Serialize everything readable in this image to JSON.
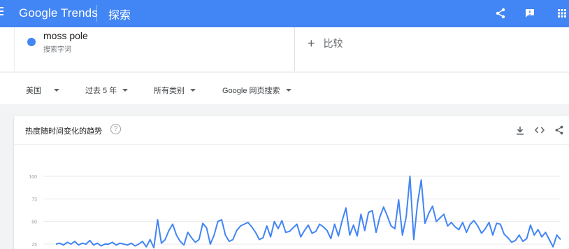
{
  "header": {
    "logo": "Google Trends",
    "page_title": "探索",
    "bg_color": "#4285f4",
    "icons": [
      "menu-icon",
      "share-icon",
      "feedback-icon",
      "apps-icon"
    ]
  },
  "search": {
    "term": "moss pole",
    "term_type": "搜索字词",
    "term_color": "#4285f4",
    "compare_label": "比较",
    "compare_icon": "+"
  },
  "filters": {
    "region": "美国",
    "time": "过去 5 年",
    "category": "所有类别",
    "property": "Google 网页搜索"
  },
  "card": {
    "title": "热度随时间变化的趋势",
    "help_icon": "?",
    "icons": [
      "download-icon",
      "embed-icon",
      "share-icon"
    ]
  },
  "chart_data": {
    "type": "line",
    "y_ticks": [
      "100",
      "75",
      "50",
      "25"
    ],
    "ylim": [
      0,
      100
    ],
    "grid": true,
    "series_color": "#4285f4",
    "series": [
      {
        "values": [
          25,
          26,
          24,
          27,
          25,
          28,
          24,
          26,
          25,
          29,
          24,
          26,
          23,
          25,
          25,
          27,
          24,
          26,
          25,
          24,
          26,
          23,
          25,
          28,
          22,
          30,
          21,
          52,
          26,
          30,
          40,
          47,
          35,
          28,
          24,
          38,
          32,
          27,
          30,
          48,
          43,
          25,
          35,
          50,
          52,
          35,
          28,
          30,
          40,
          45,
          47,
          49,
          44,
          38,
          30,
          32,
          45,
          33,
          50,
          42,
          51,
          38,
          39,
          43,
          47,
          33,
          40,
          46,
          37,
          39,
          47,
          44,
          40,
          31,
          47,
          34,
          51,
          65,
          35,
          46,
          34,
          58,
          40,
          60,
          62,
          38,
          55,
          66,
          56,
          45,
          42,
          74,
          35,
          55,
          100,
          30,
          70,
          96,
          48,
          59,
          67,
          50,
          54,
          58,
          45,
          49,
          44,
          41,
          49,
          38,
          47,
          51,
          45,
          37,
          42,
          49,
          35,
          48,
          47,
          36,
          32,
          27,
          29,
          35,
          28,
          31,
          46,
          35,
          41,
          33,
          38,
          30,
          22,
          35,
          30
        ]
      }
    ]
  }
}
